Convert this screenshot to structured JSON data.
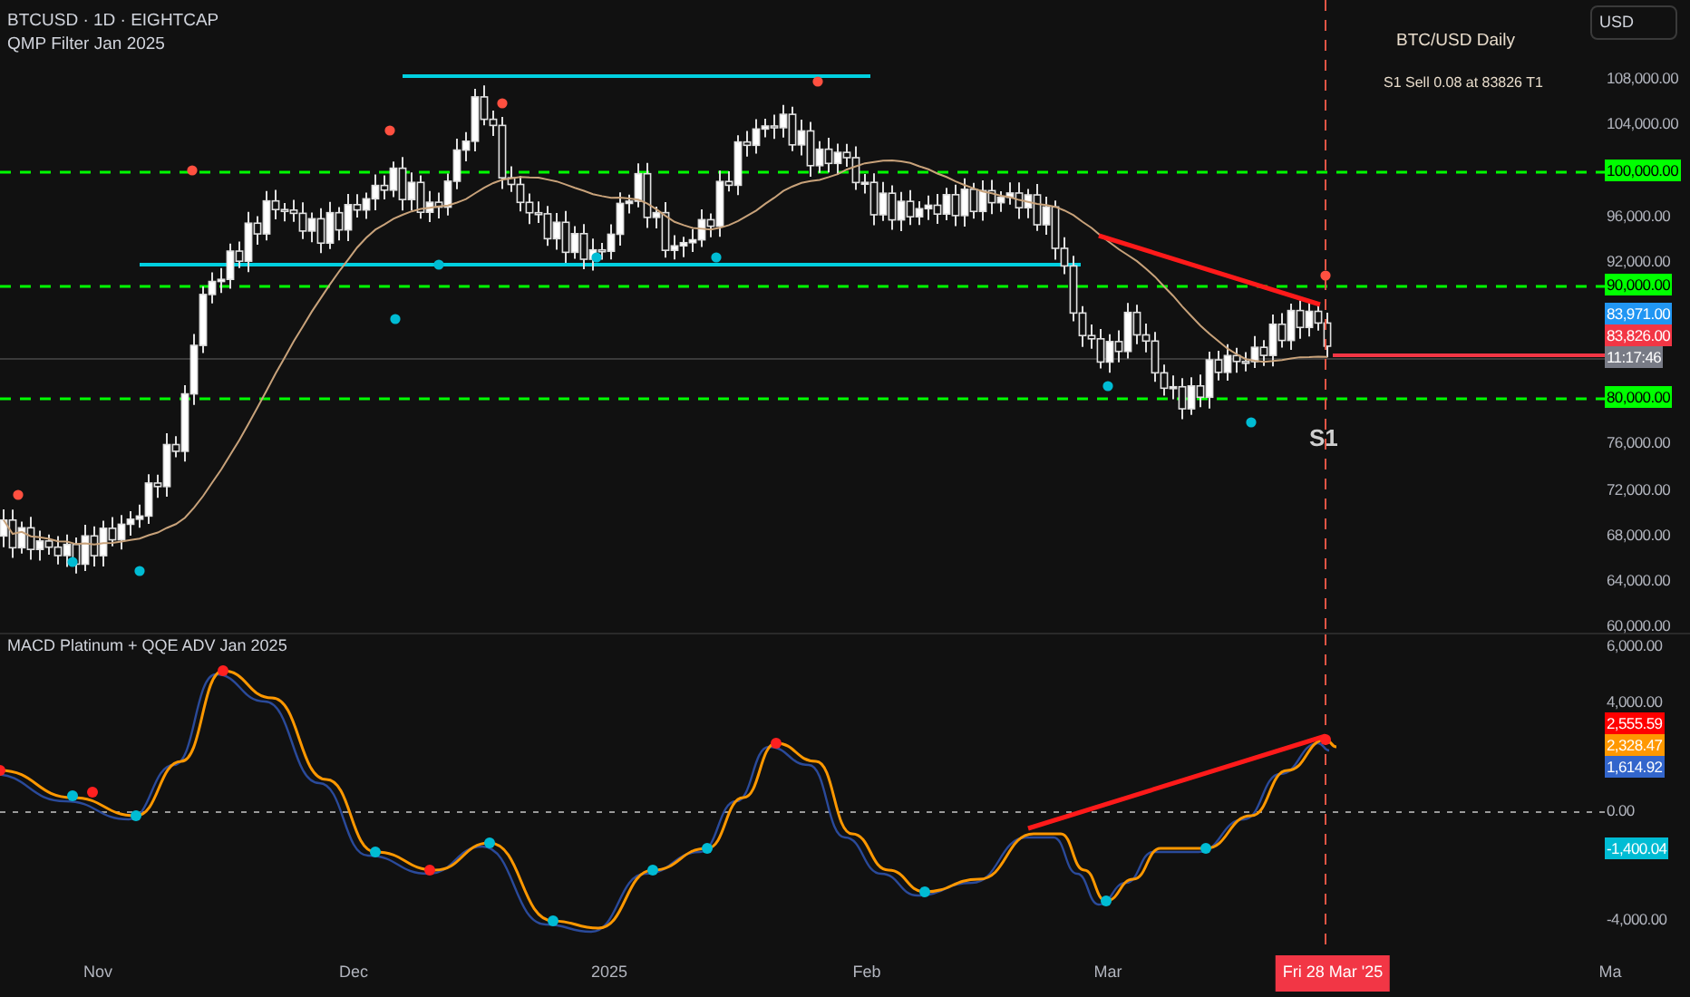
{
  "header": {
    "symbol": "BTCUSD · 1D · EIGHTCAP",
    "indicator": "QMP Filter Jan 2025"
  },
  "chart_labels": {
    "title": "BTC/USD Daily",
    "signal": "S1 Sell 0.08 at 83826 T1",
    "marker": "S1"
  },
  "currency_button": "USD",
  "price_axis": [
    {
      "label": "108,000.00",
      "kind": "tick"
    },
    {
      "label": "104,000.00",
      "kind": "tick"
    },
    {
      "label": "100,000.00",
      "kind": "level",
      "color": "#00ff00"
    },
    {
      "label": "96,000.00",
      "kind": "tick"
    },
    {
      "label": "92,000.00",
      "kind": "tick"
    },
    {
      "label": "90,000.00",
      "kind": "level",
      "color": "#00ff00"
    },
    {
      "label": "83,971.00",
      "kind": "badge",
      "color": "#2196f3"
    },
    {
      "label": "83,826.00",
      "kind": "badge",
      "color": "#f23645"
    },
    {
      "label": "11:17:46",
      "kind": "badge",
      "color": "#787b86"
    },
    {
      "label": "80,000.00",
      "kind": "level",
      "color": "#00ff00"
    },
    {
      "label": "76,000.00",
      "kind": "tick"
    },
    {
      "label": "72,000.00",
      "kind": "tick"
    },
    {
      "label": "68,000.00",
      "kind": "tick"
    },
    {
      "label": "64,000.00",
      "kind": "tick"
    },
    {
      "label": "60,000.00",
      "kind": "tick"
    }
  ],
  "oscillator": {
    "title": "MACD Platinum + QQE ADV Jan 2025"
  },
  "oscillator_axis": [
    {
      "label": "6,000.00",
      "kind": "tick"
    },
    {
      "label": "4,000.00",
      "kind": "tick"
    },
    {
      "label": "2,555.59",
      "kind": "badge",
      "color": "#ff0000"
    },
    {
      "label": "2,328.47",
      "kind": "badge",
      "color": "#ff9800"
    },
    {
      "label": "1,614.92",
      "kind": "badge",
      "color": "#3366cc"
    },
    {
      "label": "0.00",
      "kind": "tick"
    },
    {
      "label": "-1,400.04",
      "kind": "badge",
      "color": "#00bcd4"
    },
    {
      "label": "-4,000.00",
      "kind": "tick"
    }
  ],
  "time_axis": [
    {
      "label": "Nov",
      "kind": "tick"
    },
    {
      "label": "Dec",
      "kind": "tick"
    },
    {
      "label": "2025",
      "kind": "tick"
    },
    {
      "label": "Feb",
      "kind": "tick"
    },
    {
      "label": "Mar",
      "kind": "tick"
    },
    {
      "label": "Fri 28 Mar '25",
      "kind": "cursor"
    },
    {
      "label": "Ma",
      "kind": "tick"
    }
  ]
}
